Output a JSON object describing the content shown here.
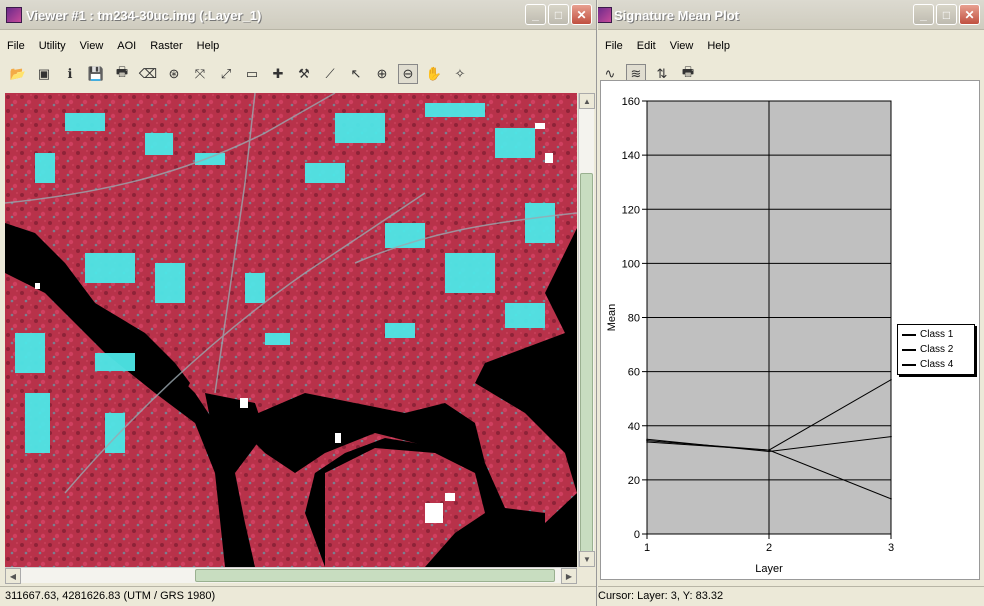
{
  "viewer": {
    "title": "Viewer #1 : tm234-30uc.img (:Layer_1)",
    "menu": [
      "File",
      "Utility",
      "View",
      "AOI",
      "Raster",
      "Help"
    ],
    "status": "311667.63, 4281626.83  (UTM / GRS 1980)",
    "toolbar_icons": [
      "open-icon",
      "new-viewer-icon",
      "info-icon",
      "save-icon",
      "print-icon",
      "eraser-icon",
      "target-icon",
      "zoom-fit-icon",
      "fullscreen-icon",
      "ruler-icon",
      "crosshair-icon",
      "hammer-icon",
      "profile-icon",
      "pointer-icon",
      "zoom-in-icon",
      "zoom-out-icon",
      "pan-hand-icon",
      "magic-wand-icon"
    ]
  },
  "plot_window": {
    "title": "Signature Mean Plot",
    "menu": [
      "File",
      "Edit",
      "View",
      "Help"
    ],
    "status": "Cursor: Layer: 3, Y: 83.32",
    "toolbar_icons": [
      "line-style-icon",
      "multi-line-icon",
      "swap-icon",
      "print-icon"
    ]
  },
  "chart_data": {
    "type": "line",
    "xlabel": "Layer",
    "ylabel": "Mean",
    "x": [
      1,
      2,
      3
    ],
    "xlim": [
      1,
      3
    ],
    "ylim": [
      0,
      160
    ],
    "yticks": [
      0,
      20,
      40,
      60,
      80,
      100,
      120,
      140,
      160
    ],
    "xticks": [
      1,
      2,
      3
    ],
    "grid": true,
    "legend_placement": "right",
    "background": "#c0c0c0",
    "series": [
      {
        "name": "Class 1",
        "values": [
          34.5,
          31,
          57
        ],
        "color": "#000000"
      },
      {
        "name": "Class 2",
        "values": [
          35,
          30.5,
          36
        ],
        "color": "#000000"
      },
      {
        "name": "Class 4",
        "values": [
          34,
          31,
          13
        ],
        "color": "#000000"
      }
    ]
  }
}
